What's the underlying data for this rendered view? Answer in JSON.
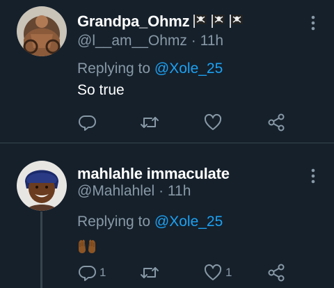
{
  "tweets": [
    {
      "display_name": "Grandpa_Ohmz",
      "name_emojis": [
        "skull-crossbones-flag",
        "skull-crossbones-flag",
        "skull-crossbones-flag"
      ],
      "handle": "@l__am__Ohmz",
      "separator": "·",
      "time": "11h",
      "replying_prefix": "Replying to ",
      "replying_to": "@Xole_25",
      "text": "So true",
      "reply_count": "",
      "retweet_count": "",
      "like_count": ""
    },
    {
      "display_name": "mahlahle immaculate",
      "handle": "@Mahlahlel",
      "separator": "·",
      "time": "11h",
      "replying_prefix": "Replying to ",
      "replying_to": "@Xole_25",
      "text_emoji": "raised-hands",
      "reply_count": "1",
      "retweet_count": "",
      "like_count": "1"
    }
  ],
  "colors": {
    "background": "#15202b",
    "secondary_text": "#8899a6",
    "accent": "#1da1f2",
    "divider": "#38444d"
  },
  "icons": [
    "reply-icon",
    "retweet-icon",
    "like-icon",
    "share-icon",
    "more-options-icon"
  ]
}
